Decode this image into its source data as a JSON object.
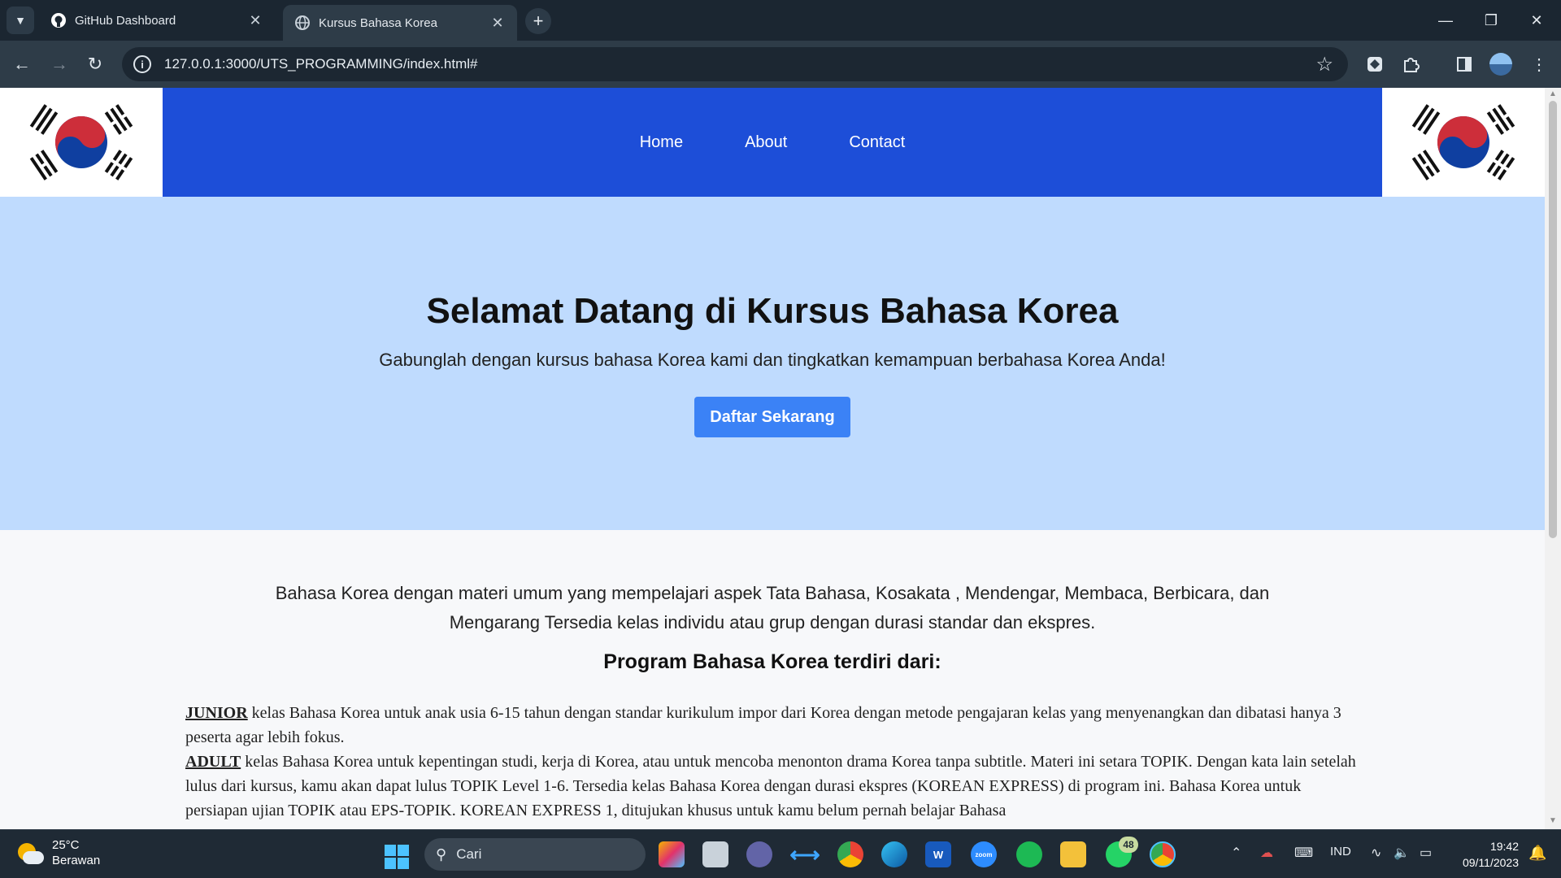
{
  "browser": {
    "tabs": [
      {
        "title": "GitHub Dashboard",
        "icon": "github-icon",
        "active": false
      },
      {
        "title": "Kursus Bahasa Korea",
        "icon": "globe-icon",
        "active": true
      }
    ],
    "url": "127.0.0.1:3000/UTS_PROGRAMMING/index.html#",
    "theme_color": "#2e3c48"
  },
  "site": {
    "nav": {
      "home": "Home",
      "about": "About",
      "contact": "Contact"
    },
    "header_color": "#1d4ed8",
    "hero": {
      "title": "Selamat Datang di Kursus Bahasa Korea",
      "subtitle": "Gabunglah dengan kursus bahasa Korea kami dan tingkatkan kemampuan berbahasa Korea Anda!",
      "cta_label": "Daftar Sekarang",
      "background": "#bfdbfe",
      "cta_color": "#3b82f6"
    },
    "intro": "Bahasa Korea dengan materi umum yang mempelajari aspek Tata Bahasa, Kosakata , Mendengar, Membaca, Berbicara, dan Mengarang Tersedia kelas individu atau grup dengan durasi standar dan ekspres.",
    "program_title": "Program Bahasa Korea terdiri dari:",
    "programs": [
      {
        "name": "JUNIOR",
        "text": " kelas Bahasa Korea untuk anak usia 6-15 tahun dengan standar kurikulum impor dari Korea dengan metode pengajaran kelas yang menyenangkan dan dibatasi hanya 3 peserta agar lebih fokus."
      },
      {
        "name": "ADULT",
        "text": " kelas Bahasa Korea untuk kepentingan studi, kerja di Korea, atau untuk mencoba menonton drama Korea tanpa subtitle. Materi ini setara TOPIK. Dengan kata lain setelah lulus dari kursus, kamu akan dapat lulus TOPIK Level 1-6. Tersedia kelas Bahasa Korea dengan durasi ekspres (KOREAN EXPRESS) di program ini. Bahasa Korea untuk persiapan ujian TOPIK atau EPS-TOPIK. KOREAN EXPRESS 1, ditujukan khusus untuk kamu belum pernah belajar Bahasa"
      }
    ]
  },
  "taskbar": {
    "weather": {
      "temp": "25°C",
      "condition": "Berawan"
    },
    "search_placeholder": "Cari",
    "whatsapp_badge": "48",
    "language": "IND",
    "time": "19:42",
    "date": "09/11/2023"
  }
}
